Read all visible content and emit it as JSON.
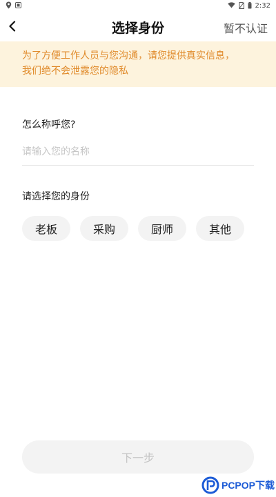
{
  "status_bar": {
    "time": "2:32",
    "left_icons": [
      "location-icon",
      "notification-icon"
    ],
    "right_icons": [
      "wifi-icon",
      "no-sim-icon",
      "battery-icon"
    ]
  },
  "nav": {
    "title": "选择身份",
    "skip_label": "暂不认证",
    "back_icon": "chevron-left-icon"
  },
  "notice": {
    "line1": "为了方便工作人员与您沟通，请您提供真实信息，",
    "line2": "我们绝不会泄露您的隐私",
    "text_color": "#e08a2a",
    "background_color": "#fdf3dd"
  },
  "form": {
    "name_label": "怎么称呼您?",
    "name_placeholder": "请输入您的名称",
    "name_value": "",
    "role_label": "请选择您的身份",
    "roles": [
      "老板",
      "采购",
      "厨师",
      "其他"
    ]
  },
  "footer": {
    "next_label": "下一步",
    "next_enabled": false
  },
  "watermark": {
    "text": "PCPOP下载",
    "color": "#1c5bd6"
  }
}
